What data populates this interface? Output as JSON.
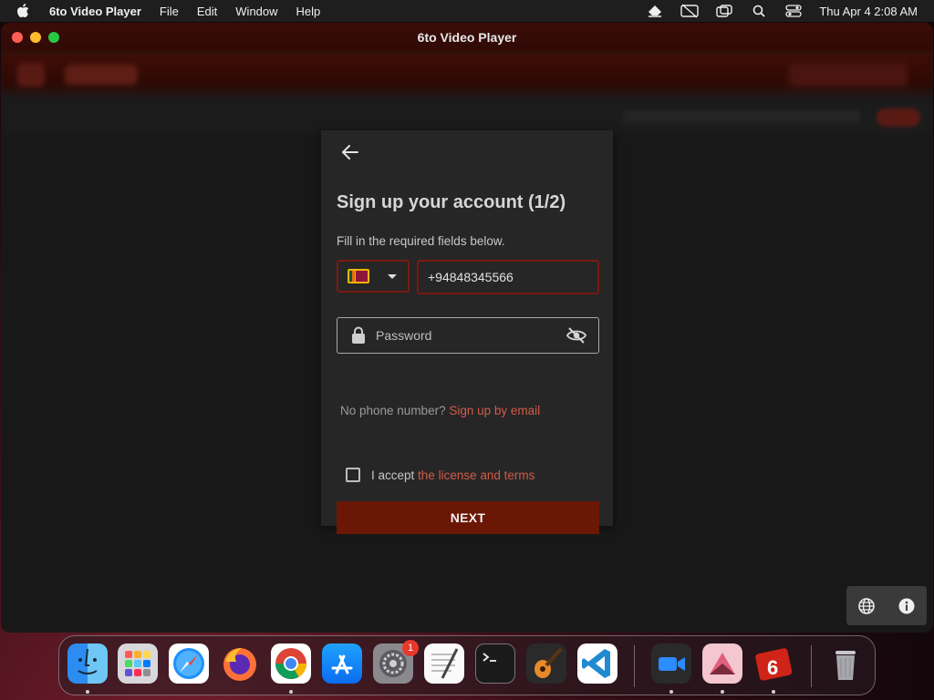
{
  "menubar": {
    "app_name": "6to Video Player",
    "menus": [
      "File",
      "Edit",
      "Window",
      "Help"
    ],
    "clock": "Thu Apr 4  2:08 AM"
  },
  "window": {
    "title": "6to Video Player"
  },
  "dialog": {
    "heading": "Sign up your account (1/2)",
    "subtext": "Fill in the required fields below.",
    "country_flag": "sri-lanka-flag",
    "phone_value": "+94848345566",
    "password_placeholder": "Password",
    "no_phone_text": "No phone number?",
    "email_link": "Sign up by email",
    "accept_text": "I accept",
    "terms_link": "the license and terms",
    "next_label": "NEXT"
  },
  "dock": {
    "apps": [
      "Finder",
      "Launchpad",
      "Safari",
      "Firefox",
      "Chrome",
      "App Store",
      "System Settings",
      "TextEdit",
      "Terminal",
      "GarageBand",
      "Visual Studio Code",
      "Zoom",
      "Affinity",
      "6to Video Player",
      "Trash"
    ],
    "settings_badge": "1"
  },
  "colors": {
    "accent": "#6b1705",
    "link": "#d25a48",
    "border_red": "#7a1a10"
  }
}
